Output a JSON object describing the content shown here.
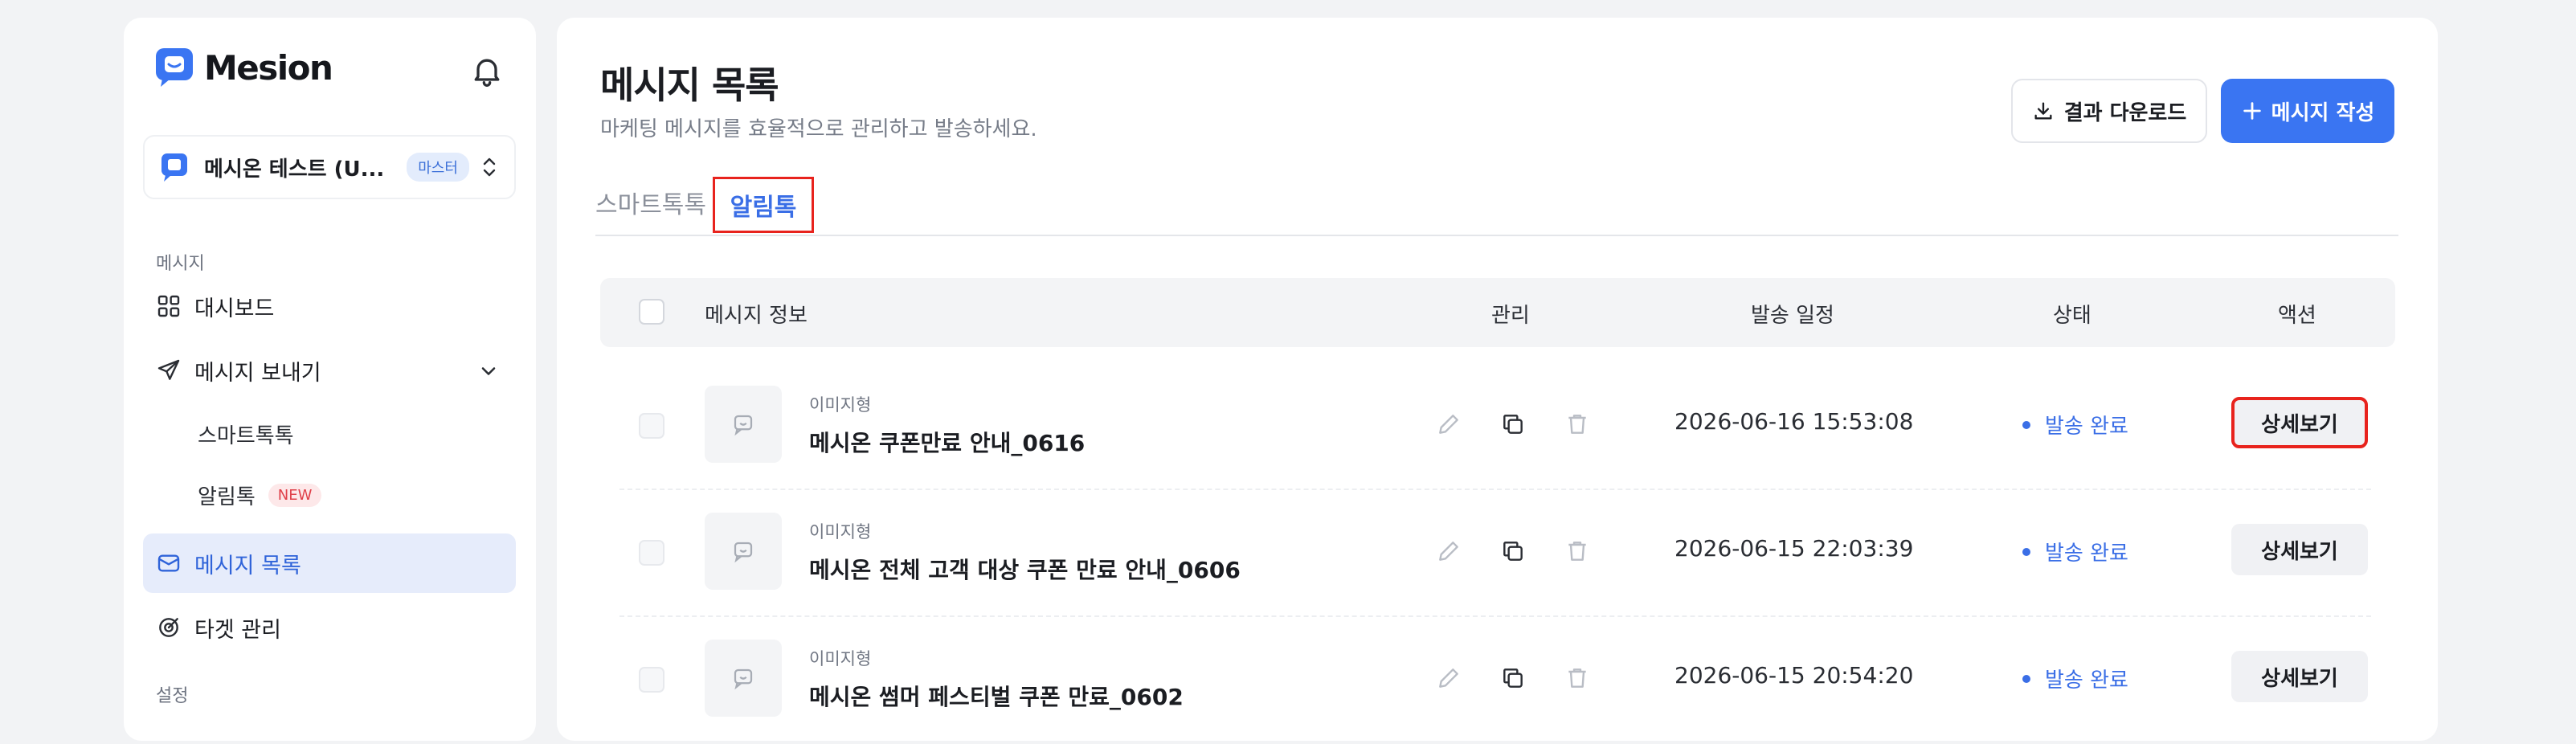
{
  "brand": {
    "name": "Mesion",
    "color": "#3a75f2"
  },
  "workspace": {
    "name": "메시온 테스트 (U...",
    "badge": "마스터"
  },
  "sidebar": {
    "section_message": "메시지",
    "section_settings": "설정",
    "items": [
      {
        "label": "대시보드",
        "icon": "dashboard-grid-icon"
      },
      {
        "label": "메시지 보내기",
        "icon": "paper-plane-icon"
      },
      {
        "label": "스마트톡톡"
      },
      {
        "label": "알림톡",
        "badge": "NEW"
      },
      {
        "label": "메시지 목록",
        "icon": "mail-icon",
        "active": true
      },
      {
        "label": "타겟 관리",
        "icon": "target-icon"
      }
    ]
  },
  "page": {
    "title": "메시지 목록",
    "subtitle": "마케팅 메시지를 효율적으로 관리하고 발송하세요.",
    "download_label": "결과 다운로드",
    "create_label": "메시지 작성"
  },
  "tabs": [
    {
      "label": "스마트톡톡",
      "active": false
    },
    {
      "label": "알림톡",
      "active": true
    }
  ],
  "table": {
    "headers": {
      "info": "메시지 정보",
      "manage": "관리",
      "date": "발송 일정",
      "status": "상태",
      "action": "액션"
    },
    "rows": [
      {
        "type": "이미지형",
        "title": "메시온 쿠폰만료 안내_0616",
        "date": "2026-06-16 15:53:08",
        "status": "발송 완료",
        "action": "상세보기"
      },
      {
        "type": "이미지형",
        "title": "메시온 전체 고객 대상 쿠폰 만료 안내_0606",
        "date": "2026-06-15 22:03:39",
        "status": "발송 완료",
        "action": "상세보기"
      },
      {
        "type": "이미지형",
        "title": "메시온 썸머 페스티벌 쿠폰 만료_0602",
        "date": "2026-06-15 20:54:20",
        "status": "발송 완료",
        "action": "상세보기"
      }
    ]
  },
  "colors": {
    "accent": "#3a75f2",
    "highlight": "#e8231d",
    "status_sent": "#3a6ee6"
  }
}
